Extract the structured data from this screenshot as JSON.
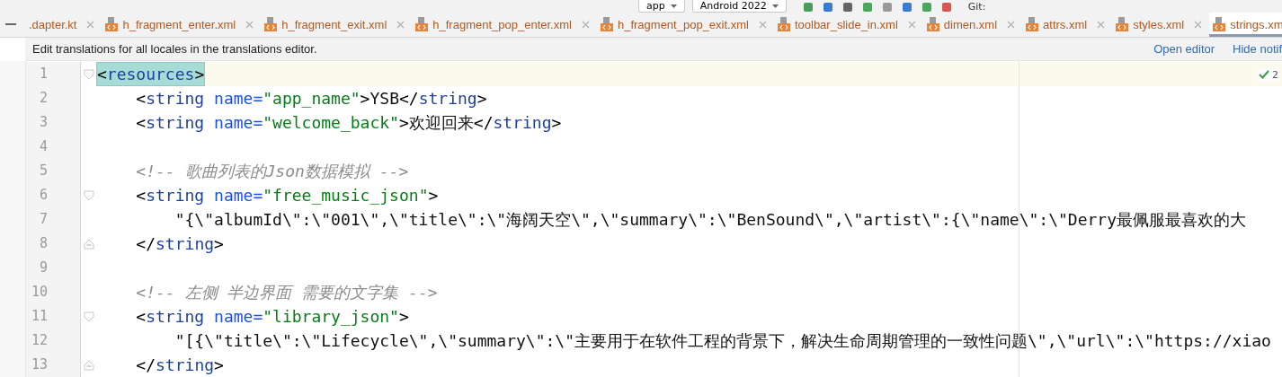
{
  "toolbar": {
    "items": [
      {
        "kind": "dropdown",
        "label": "app"
      },
      {
        "kind": "dropdown",
        "label": "Android 2022"
      },
      {
        "kind": "label",
        "label": "Git:"
      }
    ]
  },
  "tabs": [
    {
      "label": ".dapter.kt",
      "kind": "kotlin",
      "selected": false
    },
    {
      "label": "h_fragment_enter.xml",
      "kind": "xml",
      "selected": false
    },
    {
      "label": "h_fragment_exit.xml",
      "kind": "xml",
      "selected": false
    },
    {
      "label": "h_fragment_pop_enter.xml",
      "kind": "xml",
      "selected": false
    },
    {
      "label": "h_fragment_pop_exit.xml",
      "kind": "xml",
      "selected": false
    },
    {
      "label": "toolbar_slide_in.xml",
      "kind": "xml",
      "selected": false
    },
    {
      "label": "dimen.xml",
      "kind": "xml",
      "selected": false
    },
    {
      "label": "attrs.xml",
      "kind": "xml",
      "selected": false
    },
    {
      "label": "styles.xml",
      "kind": "xml",
      "selected": false
    },
    {
      "label": "strings.xm",
      "kind": "xml",
      "selected": true
    }
  ],
  "notification": {
    "message": "Edit translations for all locales in the translations editor.",
    "actions": [
      "Open editor",
      "Hide notif"
    ]
  },
  "editor": {
    "inspection_count": "2",
    "lines": [
      {
        "number": "1",
        "current": true,
        "matched": true,
        "kind": "fold-open",
        "tokens": [
          {
            "kind": "bracket",
            "text": "<"
          },
          {
            "kind": "tag",
            "text": "resources"
          },
          {
            "kind": "bracket",
            "text": ">"
          }
        ]
      },
      {
        "number": "2",
        "current": false,
        "matched": false,
        "kind": "plain",
        "tokens": [
          {
            "kind": "bracket",
            "text": "    <"
          },
          {
            "kind": "tag",
            "text": "string "
          },
          {
            "kind": "attr",
            "text": "name="
          },
          {
            "kind": "value",
            "text": "\"app_name\""
          },
          {
            "kind": "bracket",
            "text": ">"
          },
          {
            "kind": "text",
            "text": "YSB"
          },
          {
            "kind": "bracket",
            "text": "</"
          },
          {
            "kind": "tag",
            "text": "string"
          },
          {
            "kind": "bracket",
            "text": ">"
          }
        ]
      },
      {
        "number": "3",
        "current": false,
        "matched": false,
        "kind": "plain",
        "tokens": [
          {
            "kind": "bracket",
            "text": "    <"
          },
          {
            "kind": "tag",
            "text": "string "
          },
          {
            "kind": "attr",
            "text": "name="
          },
          {
            "kind": "value",
            "text": "\"welcome_back\""
          },
          {
            "kind": "bracket",
            "text": ">"
          },
          {
            "kind": "text",
            "text": "欢迎回来"
          },
          {
            "kind": "bracket",
            "text": "</"
          },
          {
            "kind": "tag",
            "text": "string"
          },
          {
            "kind": "bracket",
            "text": ">"
          }
        ]
      },
      {
        "number": "4",
        "current": false,
        "kind": "plain"
      },
      {
        "number": "5",
        "current": false,
        "matched": false,
        "kind": "plain",
        "tokens": [
          {
            "kind": "comment",
            "text": "    <!-- 歌曲列表的Json数据模拟 -->"
          }
        ]
      },
      {
        "number": "6",
        "current": false,
        "matched": false,
        "kind": "fold-open",
        "tokens": [
          {
            "kind": "bracket",
            "text": "    <"
          },
          {
            "kind": "tag",
            "text": "string "
          },
          {
            "kind": "attr",
            "text": "name="
          },
          {
            "kind": "value",
            "text": "\"free_music_json\""
          },
          {
            "kind": "bracket",
            "text": ">"
          }
        ]
      },
      {
        "number": "7",
        "current": false,
        "matched": false,
        "kind": "plain",
        "tokens": [
          {
            "kind": "text",
            "text": "        \"{\\\"albumId\\\":\\\"001\\\",\\\"title\\\":\\\"海阔天空\\\",\\\"summary\\\":\\\"BenSound\\\",\\\"artist\\\":{\\\"name\\\":\\\"Derry最佩服最喜欢的大"
          }
        ]
      },
      {
        "number": "8",
        "current": false,
        "matched": false,
        "kind": "fold-close",
        "tokens": [
          {
            "kind": "bracket",
            "text": "    </"
          },
          {
            "kind": "tag",
            "text": "string"
          },
          {
            "kind": "bracket",
            "text": ">"
          }
        ]
      },
      {
        "number": "9",
        "current": false,
        "kind": "plain"
      },
      {
        "number": "10",
        "current": false,
        "matched": false,
        "kind": "plain",
        "tokens": [
          {
            "kind": "comment",
            "text": "    <!-- 左侧 半边界面 需要的文字集 -->"
          }
        ]
      },
      {
        "number": "11",
        "current": false,
        "matched": false,
        "kind": "fold-open",
        "tokens": [
          {
            "kind": "bracket",
            "text": "    <"
          },
          {
            "kind": "tag",
            "text": "string "
          },
          {
            "kind": "attr",
            "text": "name="
          },
          {
            "kind": "value",
            "text": "\"library_json\""
          },
          {
            "kind": "bracket",
            "text": ">"
          }
        ]
      },
      {
        "number": "12",
        "current": false,
        "matched": false,
        "kind": "plain",
        "tokens": [
          {
            "kind": "text",
            "text": "        \"[{\\\"title\\\":\\\"Lifecycle\\\",\\\"summary\\\":\\\"主要用于在软件工程的背景下，解决生命周期管理的一致性问题\\\",\\\"url\\\":\\\"https://xiao"
          }
        ]
      },
      {
        "number": "13",
        "current": false,
        "matched": false,
        "kind": "fold-close",
        "tokens": [
          {
            "kind": "bracket",
            "text": "    </"
          },
          {
            "kind": "tag",
            "text": "string"
          },
          {
            "kind": "bracket",
            "text": ">"
          }
        ]
      }
    ]
  }
}
